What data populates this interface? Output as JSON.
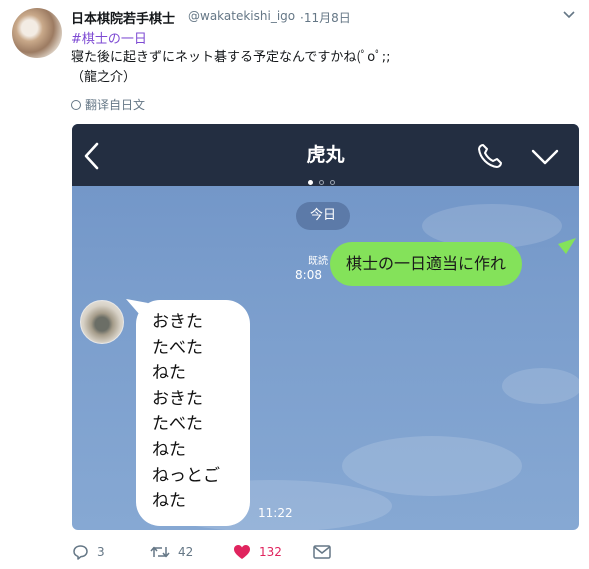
{
  "tweet": {
    "author_name": "日本棋院若手棋士",
    "handle": "@wakatekishi_igo",
    "date": "·11月8日",
    "hashtag": "#棋士の一日",
    "body_line1": "寝た後に起きずにネット碁する予定なんですかね(ﾟoﾟ;;",
    "body_line2": "（龍之介）",
    "translate_label": "翻译自日文"
  },
  "chat": {
    "contact_name": "虎丸",
    "date_pill": "今日",
    "read_label": "既読",
    "outgoing_time": "8:08",
    "outgoing_message": "棋士の一日適当に作れ",
    "incoming_lines": [
      "おきた",
      "たべた",
      "ねた",
      "おきた",
      "たべた",
      "ねた",
      "ねっとご",
      "ねた"
    ],
    "incoming_time": "11:22",
    "page_dots": 3,
    "active_dot": 0,
    "colors": {
      "header": "#232e41",
      "background": "#7a9dcc",
      "outgoing_bubble": "#84e25a",
      "incoming_bubble": "#ffffff"
    }
  },
  "actions": {
    "reply_count": "3",
    "retweet_count": "42",
    "like_count": "132",
    "like_color": "#e0245e",
    "icons": [
      "reply-icon",
      "retweet-icon",
      "heart-icon",
      "mail-icon"
    ]
  }
}
